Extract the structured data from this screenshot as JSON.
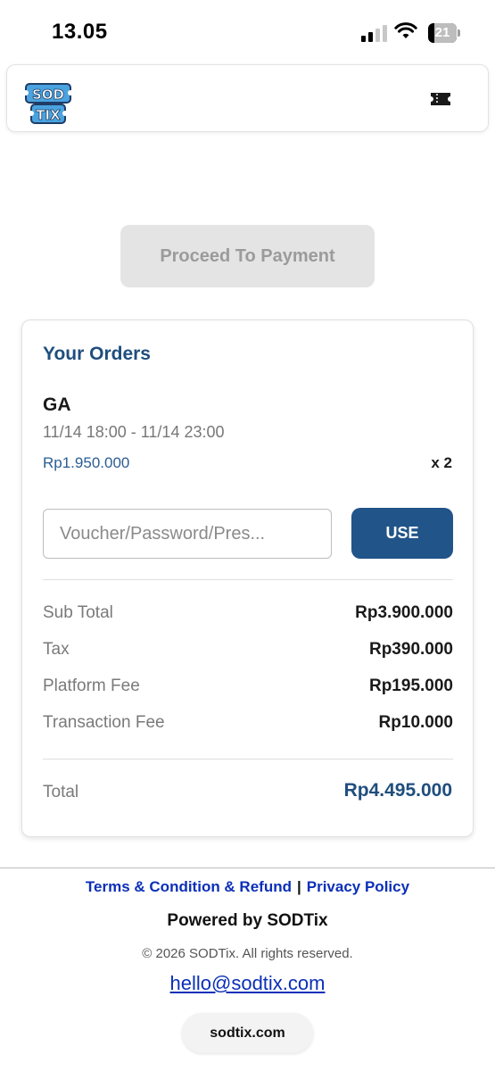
{
  "status_bar": {
    "time": "13.05",
    "battery_level": "21",
    "battery_percent": 21
  },
  "header": {
    "logo_text_top": "SOD",
    "logo_text_bottom": "TIX",
    "ticket_icon": "ticket-icon"
  },
  "proceed_button_label": "Proceed To Payment",
  "orders": {
    "title": "Your Orders",
    "item": {
      "name": "GA",
      "time": "11/14 18:00 - 11/14 23:00",
      "price": "Rp1.950.000",
      "qty": "x 2"
    },
    "voucher_placeholder": "Voucher/Password/Pres...",
    "use_label": "USE",
    "summary": [
      {
        "label": "Sub Total",
        "value": "Rp3.900.000"
      },
      {
        "label": "Tax",
        "value": "Rp390.000"
      },
      {
        "label": "Platform Fee",
        "value": "Rp195.000"
      },
      {
        "label": "Transaction Fee",
        "value": "Rp10.000"
      }
    ],
    "total_label": "Total",
    "total_value": "Rp4.495.000"
  },
  "footer": {
    "terms_link": "Terms & Condition & Refund",
    "separator": "|",
    "privacy_link": "Privacy Policy",
    "powered_by": "Powered by SODTix",
    "copyright": "© 2026 SODTix. All rights reserved.",
    "email": "hello@sodtix.com",
    "url": "sodtix.com"
  },
  "colors": {
    "brand_blue": "#215488",
    "title_blue": "#1f4e7d",
    "link_blue": "#0b2fb8",
    "logo_blue": "#4aa3df"
  }
}
